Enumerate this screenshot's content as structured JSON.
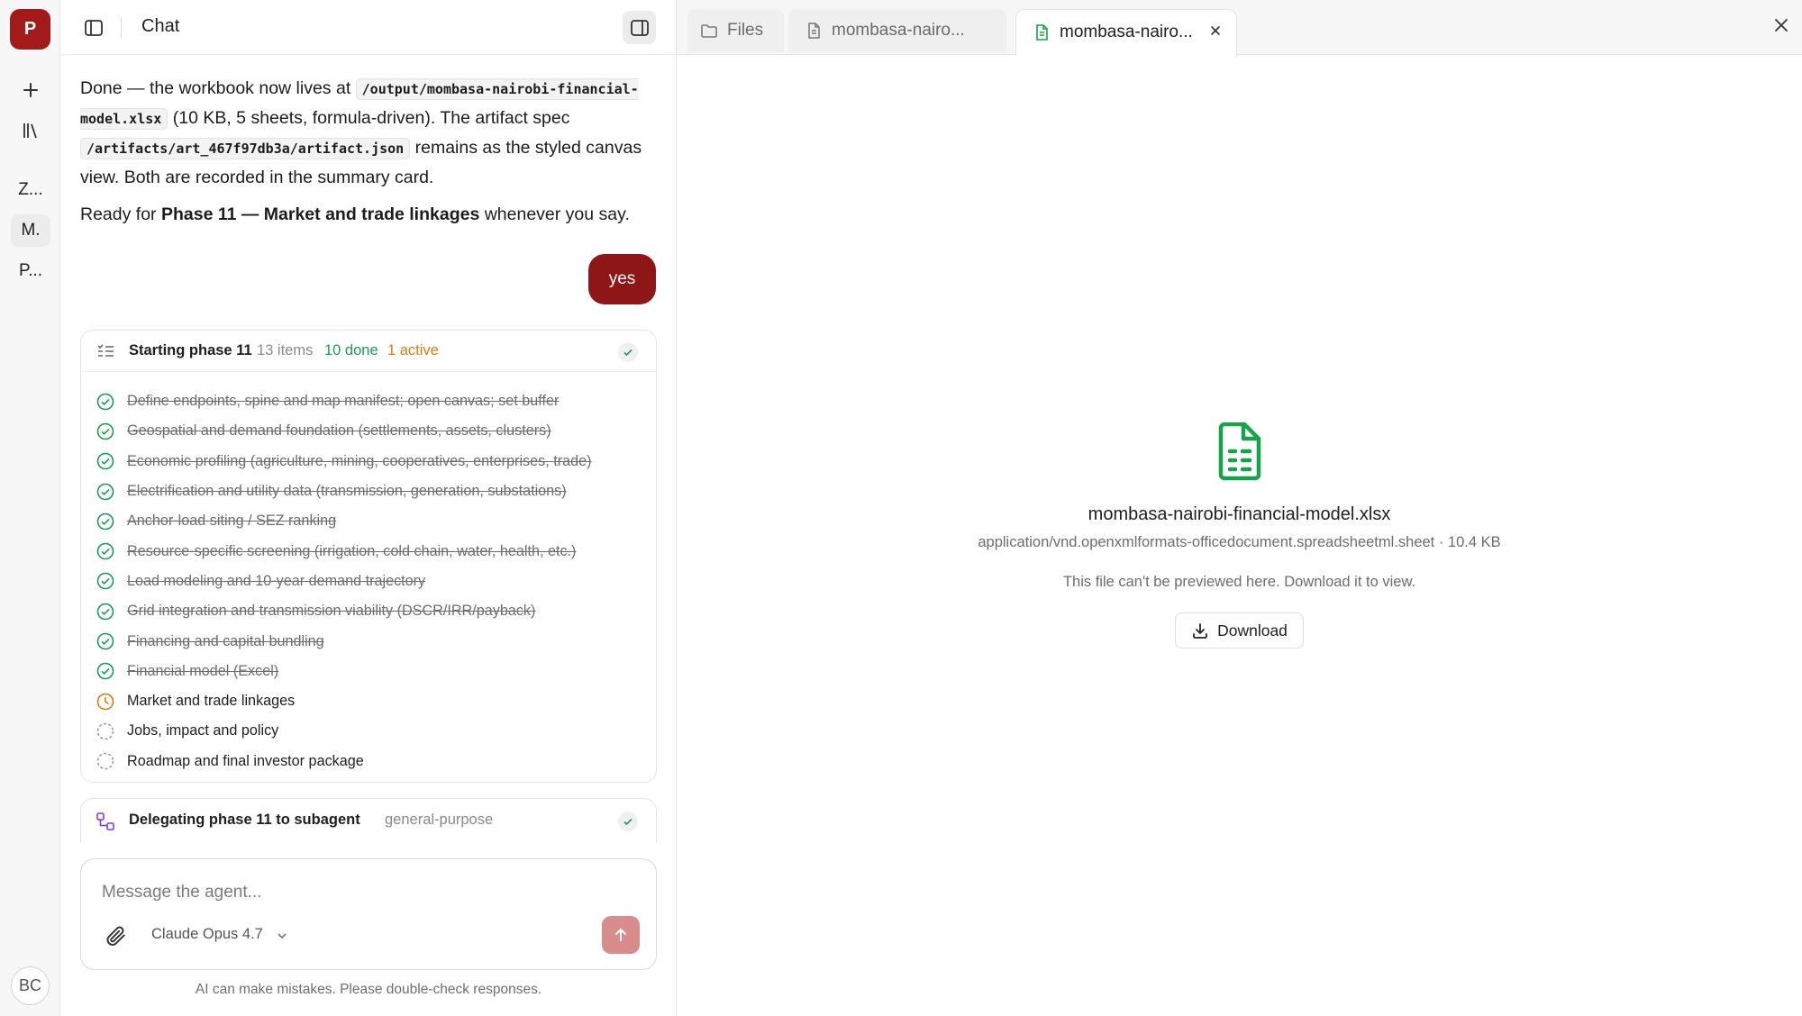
{
  "rail": {
    "logo_letter": "P",
    "items": [
      "Z...",
      "M.",
      "P..."
    ],
    "avatar": "BC"
  },
  "chat": {
    "title": "Chat",
    "assistant_message": {
      "part1": "Done — the workbook now lives at ",
      "path1": "/output/mombasa-nairobi-financial-model.xlsx",
      "part2": " (10 KB, 5 sheets, formula-driven). The artifact spec ",
      "path2": "/artifacts/art_467f97db3a/artifact.json",
      "part3": " remains as the styled canvas view. Both are recorded in the summary card.",
      "ready_prefix": "Ready for ",
      "ready_bold": "Phase 11 — Market and trade linkages",
      "ready_suffix": " whenever you say."
    },
    "user_message": "yes",
    "todo": {
      "title": "Starting phase 11",
      "count": "13 items",
      "done": "10 done",
      "active": "1 active",
      "items": [
        {
          "label": "Define endpoints, spine and map manifest; open canvas; set buffer",
          "status": "done"
        },
        {
          "label": "Geospatial and demand foundation (settlements, assets, clusters)",
          "status": "done"
        },
        {
          "label": "Economic profiling (agriculture, mining, cooperatives, enterprises, trade)",
          "status": "done"
        },
        {
          "label": "Electrification and utility data (transmission, generation, substations)",
          "status": "done"
        },
        {
          "label": "Anchor-load siting / SEZ ranking",
          "status": "done"
        },
        {
          "label": "Resource-specific screening (irrigation, cold chain, water, health, etc.)",
          "status": "done"
        },
        {
          "label": "Load modeling and 10-year demand trajectory",
          "status": "done"
        },
        {
          "label": "Grid integration and transmission viability (DSCR/IRR/payback)",
          "status": "done"
        },
        {
          "label": "Financing and capital bundling",
          "status": "done"
        },
        {
          "label": "Financial model (Excel)",
          "status": "done"
        },
        {
          "label": "Market and trade linkages",
          "status": "active"
        },
        {
          "label": "Jobs, impact and policy",
          "status": "pending"
        },
        {
          "label": "Roadmap and final investor package",
          "status": "pending"
        }
      ]
    },
    "delegation": {
      "title": "Delegating phase 11 to subagent",
      "tag": "general-purpose"
    },
    "composer": {
      "placeholder": "Message the agent...",
      "model": "Claude Opus 4.7"
    },
    "disclaimer": "AI can make mistakes. Please double-check responses."
  },
  "tabs": {
    "files": "Files",
    "tab1": "mombasa-nairo...",
    "tab2": "mombasa-nairo..."
  },
  "preview": {
    "filename": "mombasa-nairobi-financial-model.xlsx",
    "meta": "application/vnd.openxmlformats-officedocument.spreadsheetml.sheet · 10.4 KB",
    "note": "This file can't be previewed here. Download it to view.",
    "download": "Download"
  },
  "colors": {
    "brand": "#a31a1a",
    "user_bubble": "#8e1616",
    "done_green": "#1a9c55",
    "active_orange": "#dd7a16",
    "file_green": "#16a34a"
  }
}
